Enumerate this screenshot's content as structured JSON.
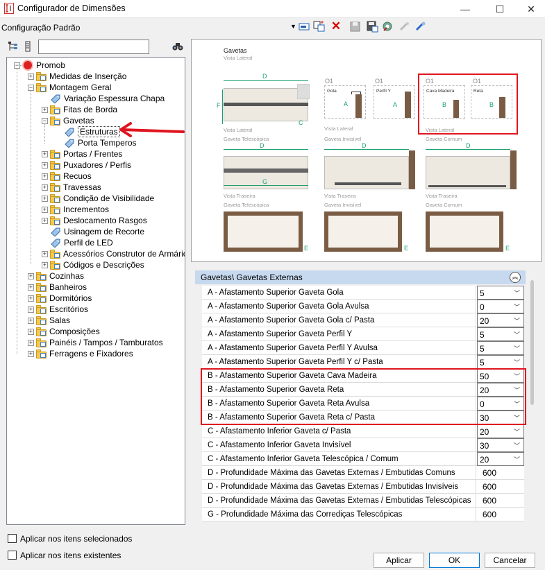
{
  "window": {
    "title": "Configurador de Dimensões",
    "controls": [
      "—",
      "☐",
      "✕"
    ]
  },
  "toolbar": {
    "configuration": "Configuração Padrão",
    "icons": [
      "dropdown-arrow-icon",
      "apply-config-icon",
      "copy-config-icon",
      "delete-icon",
      "save-icon",
      "save-as-icon",
      "settings-icon",
      "link-disabled-icon",
      "link-icon"
    ]
  },
  "search": {
    "value": "",
    "binoculars": "binoculars-icon"
  },
  "tree": {
    "root": "Promob",
    "items": [
      {
        "label": "Medidas de Inserção",
        "level": 1,
        "type": "folder",
        "expander": "+"
      },
      {
        "label": "Montagem Geral",
        "level": 1,
        "type": "folder",
        "expander": "−"
      },
      {
        "label": "Variação Espessura Chapa",
        "level": 2,
        "type": "tag"
      },
      {
        "label": "Fitas de Borda",
        "level": 2,
        "type": "folder",
        "expander": "+"
      },
      {
        "label": "Gavetas",
        "level": 2,
        "type": "folder",
        "expander": "−"
      },
      {
        "label": "Estruturas",
        "level": 3,
        "type": "tag",
        "selected": true
      },
      {
        "label": "Porta Temperos",
        "level": 3,
        "type": "tag"
      },
      {
        "label": "Portas / Frentes",
        "level": 2,
        "type": "folder",
        "expander": "+"
      },
      {
        "label": "Puxadores / Perfis",
        "level": 2,
        "type": "folder",
        "expander": "+"
      },
      {
        "label": "Recuos",
        "level": 2,
        "type": "folder",
        "expander": "+"
      },
      {
        "label": "Travessas",
        "level": 2,
        "type": "folder",
        "expander": "+"
      },
      {
        "label": "Condição de Visibilidade",
        "level": 2,
        "type": "folder",
        "expander": "+"
      },
      {
        "label": "Incrementos",
        "level": 2,
        "type": "folder",
        "expander": "+"
      },
      {
        "label": "Deslocamento Rasgos",
        "level": 2,
        "type": "folder",
        "expander": "+"
      },
      {
        "label": "Usinagem de Recorte",
        "level": 2,
        "type": "tag"
      },
      {
        "label": "Perfil de LED",
        "level": 2,
        "type": "tag"
      },
      {
        "label": "Acessórios Construtor de Armários",
        "level": 2,
        "type": "folder",
        "expander": "+"
      },
      {
        "label": "Códigos e Descrições",
        "level": 2,
        "type": "folder",
        "expander": "+"
      },
      {
        "label": "Cozinhas",
        "level": 1,
        "type": "folder",
        "expander": "+"
      },
      {
        "label": "Banheiros",
        "level": 1,
        "type": "folder",
        "expander": "+"
      },
      {
        "label": "Dormitórios",
        "level": 1,
        "type": "folder",
        "expander": "+"
      },
      {
        "label": "Escritórios",
        "level": 1,
        "type": "folder",
        "expander": "+"
      },
      {
        "label": "Salas",
        "level": 1,
        "type": "folder",
        "expander": "+"
      },
      {
        "label": "Composições",
        "level": 1,
        "type": "folder",
        "expander": "+"
      },
      {
        "label": "Painéis / Tampos / Tamburatos",
        "level": 1,
        "type": "folder",
        "expander": "+"
      },
      {
        "label": "Ferragens e Fixadores",
        "level": 1,
        "type": "folder",
        "expander": "+"
      }
    ]
  },
  "preview": {
    "title": "Gavetas",
    "subtitle": "Vista Lateral",
    "dims": {
      "D": "D",
      "F": "F",
      "C": "C",
      "A": "A",
      "B": "B",
      "G": "G",
      "E": "E"
    },
    "o1": "O1",
    "profiles": [
      "Gola",
      "Perfil Y",
      "Cava Madeira",
      "Reta"
    ],
    "captions": {
      "vista_lateral": "Vista Lateral",
      "gaveta_telescopica": "Gaveta Telescópica",
      "gaveta_invisivel": "Gaveta Invisível",
      "gaveta_comum": "Gaveta Comum",
      "vista_traseira": "Vista Traseira"
    }
  },
  "properties": {
    "header": "Gavetas\\ Gavetas Externas",
    "rows": [
      {
        "name": "A - Afastamento Superior Gaveta Gola",
        "value": "5",
        "dropdown": true
      },
      {
        "name": "A - Afastamento Superior Gaveta Gola Avulsa",
        "value": "0",
        "dropdown": true
      },
      {
        "name": "A - Afastamento Superior Gaveta Gola c/ Pasta",
        "value": "20",
        "dropdown": true
      },
      {
        "name": "A - Afastamento Superior Gaveta Perfil Y",
        "value": "5",
        "dropdown": true
      },
      {
        "name": "A - Afastamento Superior Gaveta Perfil Y Avulsa",
        "value": "5",
        "dropdown": true
      },
      {
        "name": "A - Afastamento Superior Gaveta Perfil Y c/ Pasta",
        "value": "5",
        "dropdown": true
      },
      {
        "name": "B - Afastamento Superior Gaveta Cava Madeira",
        "value": "50",
        "dropdown": true
      },
      {
        "name": "B - Afastamento Superior Gaveta Reta",
        "value": "20",
        "dropdown": true
      },
      {
        "name": "B - Afastamento Superior Gaveta Reta Avulsa",
        "value": "0",
        "dropdown": true
      },
      {
        "name": "B - Afastamento Superior Gaveta Reta c/ Pasta",
        "value": "30",
        "dropdown": true
      },
      {
        "name": "C - Afastamento Inferior Gaveta c/ Pasta",
        "value": "20",
        "dropdown": true
      },
      {
        "name": "C - Afastamento Inferior Gaveta Invisível",
        "value": "30",
        "dropdown": true
      },
      {
        "name": "C - Afastamento Inferior Gaveta Telescópica / Comum",
        "value": "20",
        "dropdown": true
      },
      {
        "name": "D - Profundidade Máxima das Gavetas Externas / Embutidas Comuns",
        "value": "600",
        "dropdown": false
      },
      {
        "name": "D - Profundidade Máxima das Gavetas Externas / Embutidas Invisíveis",
        "value": "600",
        "dropdown": false
      },
      {
        "name": "D - Profundidade Máxima das Gavetas Externas / Embutidas Telescópicas",
        "value": "600",
        "dropdown": false
      },
      {
        "name": "G - Profundidade Máxima das Corrediças Telescópicas",
        "value": "600",
        "dropdown": false
      }
    ]
  },
  "checkboxes": {
    "apply_selected": {
      "label": "Aplicar nos itens selecionados",
      "checked": false
    },
    "apply_existing": {
      "label": "Aplicar nos itens existentes",
      "checked": false
    }
  },
  "buttons": {
    "apply": "Aplicar",
    "ok": "OK",
    "cancel": "Cancelar"
  },
  "colors": {
    "highlight_red": "#e0141e",
    "header_blue": "#c7d9ee",
    "dimension_green": "#1ea06e"
  }
}
